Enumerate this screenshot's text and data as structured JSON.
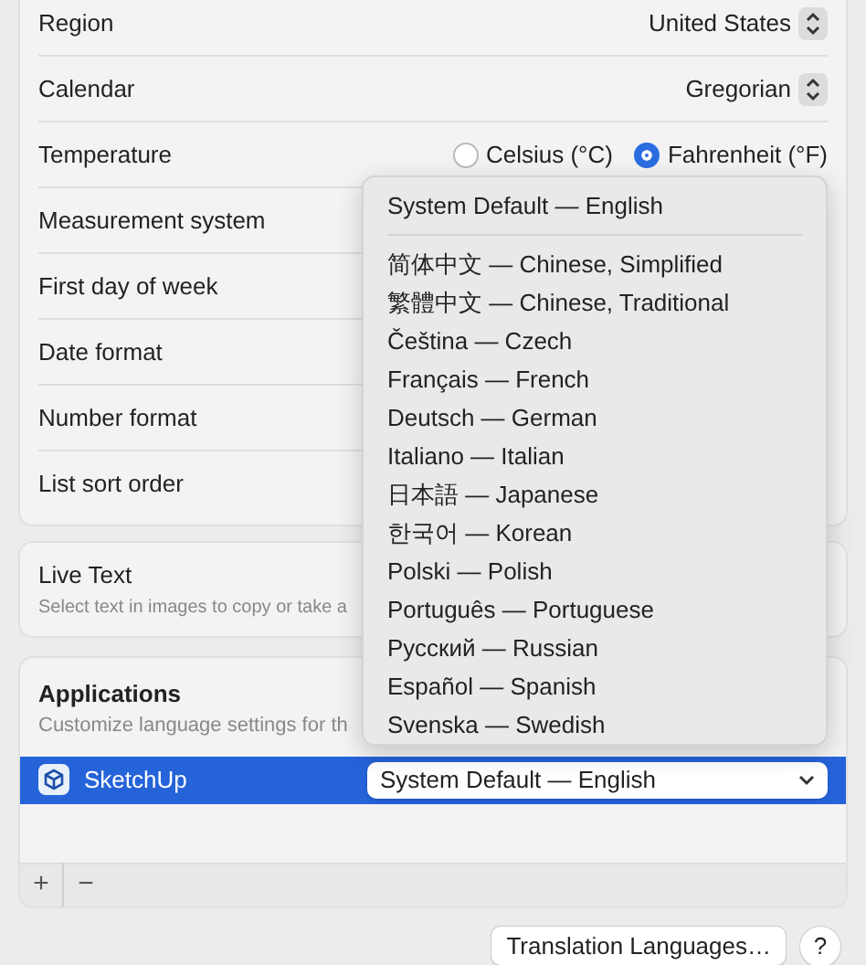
{
  "settings": [
    {
      "label": "Region",
      "kind": "popup",
      "value": "United States"
    },
    {
      "label": "Calendar",
      "kind": "popup",
      "value": "Gregorian"
    },
    {
      "label": "Temperature",
      "kind": "radio",
      "options": [
        {
          "label": "Celsius (°C)",
          "selected": false
        },
        {
          "label": "Fahrenheit (°F)",
          "selected": true
        }
      ]
    },
    {
      "label": "Measurement system",
      "kind": "plain"
    },
    {
      "label": "First day of week",
      "kind": "plain"
    },
    {
      "label": "Date format",
      "kind": "plain"
    },
    {
      "label": "Number format",
      "kind": "plain"
    },
    {
      "label": "List sort order",
      "kind": "plain"
    }
  ],
  "live_text": {
    "title": "Live Text",
    "description": "Select text in images to copy or take a"
  },
  "applications": {
    "title": "Applications",
    "description": "Customize language settings for th",
    "apps": [
      {
        "name": "SketchUp",
        "language": "System Default — English",
        "selected": true
      }
    ],
    "add": "+",
    "remove": "−"
  },
  "menu": {
    "header": "System Default — English",
    "items": [
      "简体中文 — Chinese, Simplified",
      "繁體中文 — Chinese, Traditional",
      "Čeština — Czech",
      "Français — French",
      "Deutsch — German",
      "Italiano — Italian",
      "日本語 — Japanese",
      "한국어 — Korean",
      "Polski — Polish",
      "Português — Portuguese",
      "Русский — Russian",
      "Español — Spanish",
      "Svenska — Swedish"
    ]
  },
  "buttons": {
    "translation": "Translation Languages…",
    "help": "?"
  }
}
